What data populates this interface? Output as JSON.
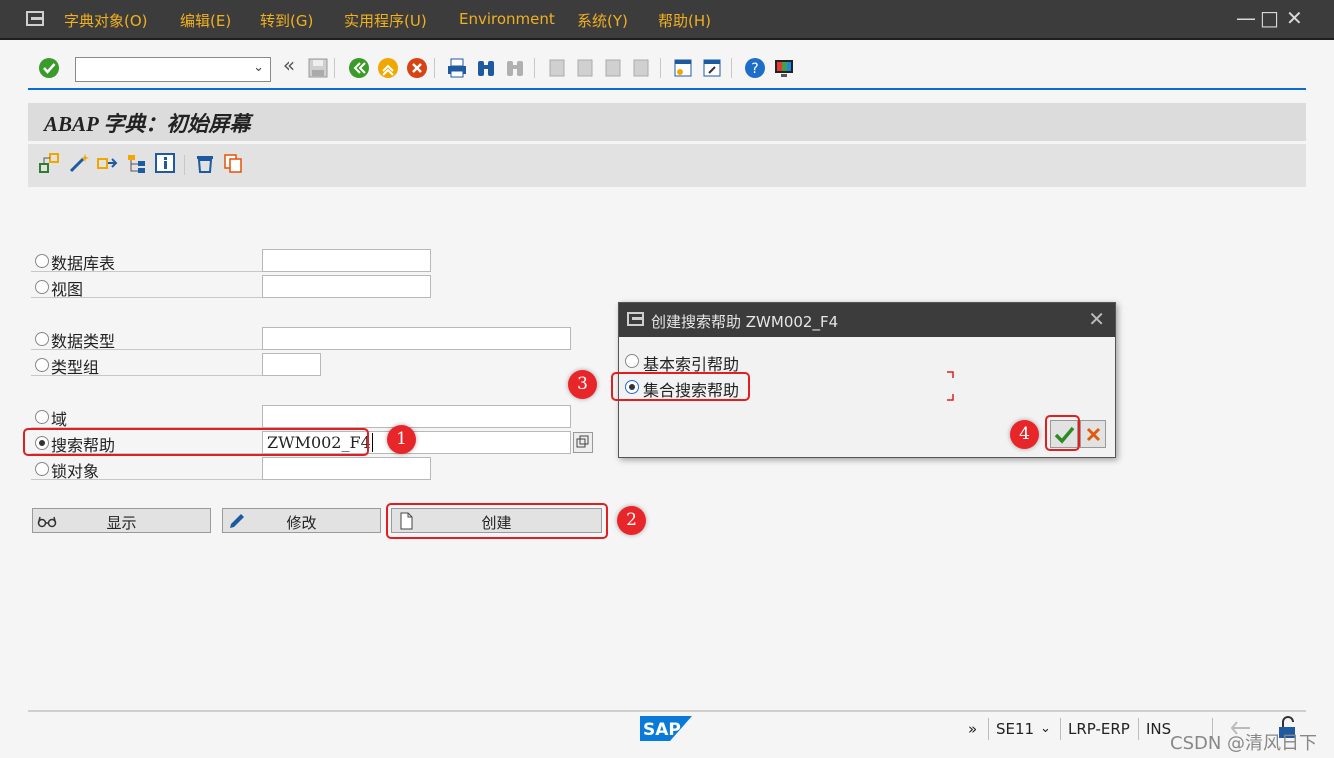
{
  "menubar": {
    "items": [
      "字典对象(O)",
      "编辑(E)",
      "转到(G)",
      "实用程序(U)",
      "Environment",
      "系统(Y)",
      "帮助(H)"
    ],
    "window_buttons": [
      "—",
      "□",
      "✕"
    ]
  },
  "toolbar": {
    "command_field_value": "",
    "back_label": "«"
  },
  "title": "ABAP 字典：初始屏幕",
  "form": {
    "database_table_label": "数据库表",
    "view_label": "视图",
    "data_type_label": "数据类型",
    "type_group_label": "类型组",
    "domain_label": "域",
    "search_help_label": "搜索帮助",
    "search_help_value": "ZWM002_F4",
    "lock_object_label": "锁对象",
    "selected": "search_help"
  },
  "buttons": {
    "display": "显示",
    "change": "修改",
    "create": "创建"
  },
  "dialog": {
    "title": "创建搜索帮助 ZWM002_F4",
    "option_elementary": "基本索引帮助",
    "option_collective": "集合搜索帮助",
    "selected": "collective"
  },
  "annotations": [
    "1",
    "2",
    "3",
    "4"
  ],
  "statusbar": {
    "expand": "»",
    "transaction": "SE11",
    "system": "LRP-ERP",
    "mode": "INS",
    "sap_logo": "SAP"
  },
  "watermark": "CSDN @清风日下",
  "colors": {
    "menu_bg": "#3c3c3c",
    "menu_text": "#f0b020",
    "accent": "#0a6ed1",
    "highlight": "#e02020",
    "badge": "#e8262a"
  }
}
